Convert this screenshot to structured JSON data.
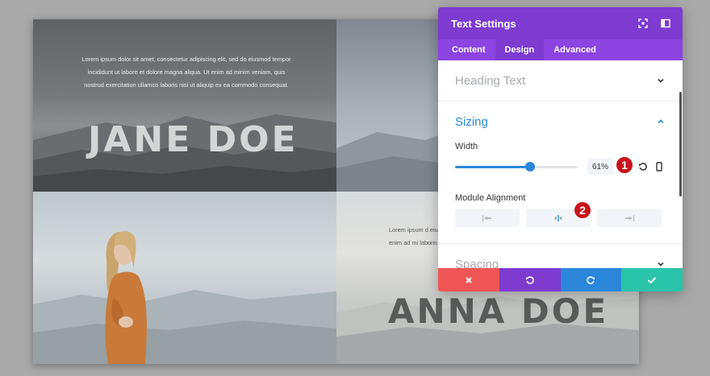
{
  "canvas": {
    "top_left": {
      "text": "Lorem ipsum dolor sit amet, consectetur adipiscing elit, sed do eiusmod tempor incididunt ut labore et dolore magna aliqua. Ut enim ad minim veniam, quis nostrud exercitation ullamco laboris nisi ut aliquip ex ea commodo consequat.",
      "name": "JANE DOE"
    },
    "bottom_right": {
      "text": "Lorem ipsum d eiusmod tempo enim ad mi laboris",
      "name": "ANNA DOE"
    }
  },
  "panel": {
    "title": "Text Settings",
    "tabs": [
      {
        "label": "Content",
        "active": false
      },
      {
        "label": "Design",
        "active": true
      },
      {
        "label": "Advanced",
        "active": false
      }
    ],
    "sections": {
      "heading": {
        "title": "Heading Text"
      },
      "sizing": {
        "title": "Sizing",
        "width_label": "Width",
        "width_value": "61%",
        "width_fraction": 0.61,
        "alignment_label": "Module Alignment"
      },
      "spacing": {
        "title": "Spacing"
      }
    },
    "badges": [
      "1",
      "2"
    ]
  },
  "colors": {
    "header": "#7d3bd0",
    "tabs": "#8c44e2",
    "accent": "#2b87da",
    "cancel": "#ef5555",
    "save": "#29c4a9",
    "badge": "#c8141c"
  },
  "icons": {
    "header": [
      "expand-icon",
      "sidebar-icon"
    ],
    "width_row": [
      "reset-icon",
      "phone-icon"
    ],
    "alignment": [
      "align-left-icon",
      "align-center-icon",
      "align-right-icon"
    ],
    "footer": [
      "close-icon",
      "undo-icon",
      "redo-icon",
      "check-icon"
    ]
  }
}
